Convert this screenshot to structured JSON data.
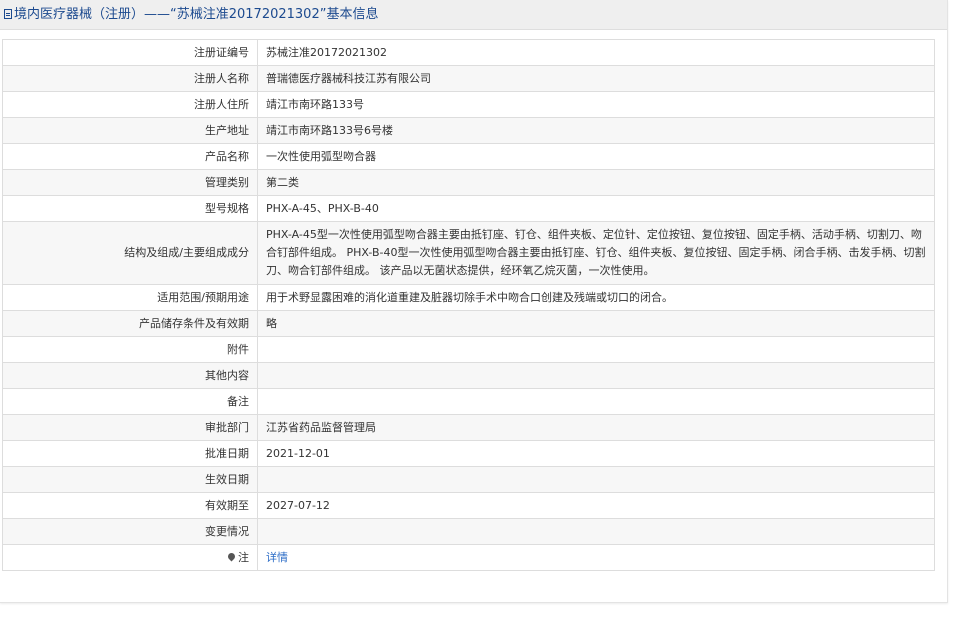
{
  "header": {
    "title": "境内医疗器械（注册）——“苏械注准20172021302”基本信息"
  },
  "rows": [
    {
      "label": "注册证编号",
      "value": "苏械注准20172021302"
    },
    {
      "label": "注册人名称",
      "value": "普瑞德医疗器械科技江苏有限公司"
    },
    {
      "label": "注册人住所",
      "value": "靖江市南环路133号"
    },
    {
      "label": "生产地址",
      "value": "靖江市南环路133号6号楼"
    },
    {
      "label": "产品名称",
      "value": "一次性使用弧型吻合器"
    },
    {
      "label": "管理类别",
      "value": "第二类"
    },
    {
      "label": "型号规格",
      "value": "PHX-A-45、PHX-B-40"
    },
    {
      "label": "结构及组成/主要组成成分",
      "value": "PHX-A-45型一次性使用弧型吻合器主要由抵钉座、钉仓、组件夹板、定位针、定位按钮、复位按钮、固定手柄、活动手柄、切割刀、吻合钉部件组成。 PHX-B-40型一次性使用弧型吻合器主要由抵钉座、钉仓、组件夹板、复位按钮、固定手柄、闭合手柄、击发手柄、切割刀、吻合钉部件组成。 该产品以无菌状态提供，经环氧乙烷灭菌，一次性使用。"
    },
    {
      "label": "适用范围/预期用途",
      "value": "用于术野显露困难的消化道重建及脏器切除手术中吻合口创建及残端或切口的闭合。"
    },
    {
      "label": "产品储存条件及有效期",
      "value": "略"
    },
    {
      "label": "附件",
      "value": ""
    },
    {
      "label": "其他内容",
      "value": ""
    },
    {
      "label": "备注",
      "value": ""
    },
    {
      "label": "审批部门",
      "value": "江苏省药品监督管理局"
    },
    {
      "label": "批准日期",
      "value": "2021-12-01"
    },
    {
      "label": "生效日期",
      "value": ""
    },
    {
      "label": "有效期至",
      "value": "2027-07-12"
    },
    {
      "label": "变更情况",
      "value": ""
    }
  ],
  "note_row": {
    "label": "注",
    "icon": "map-pin-icon",
    "link_text": "详情"
  }
}
